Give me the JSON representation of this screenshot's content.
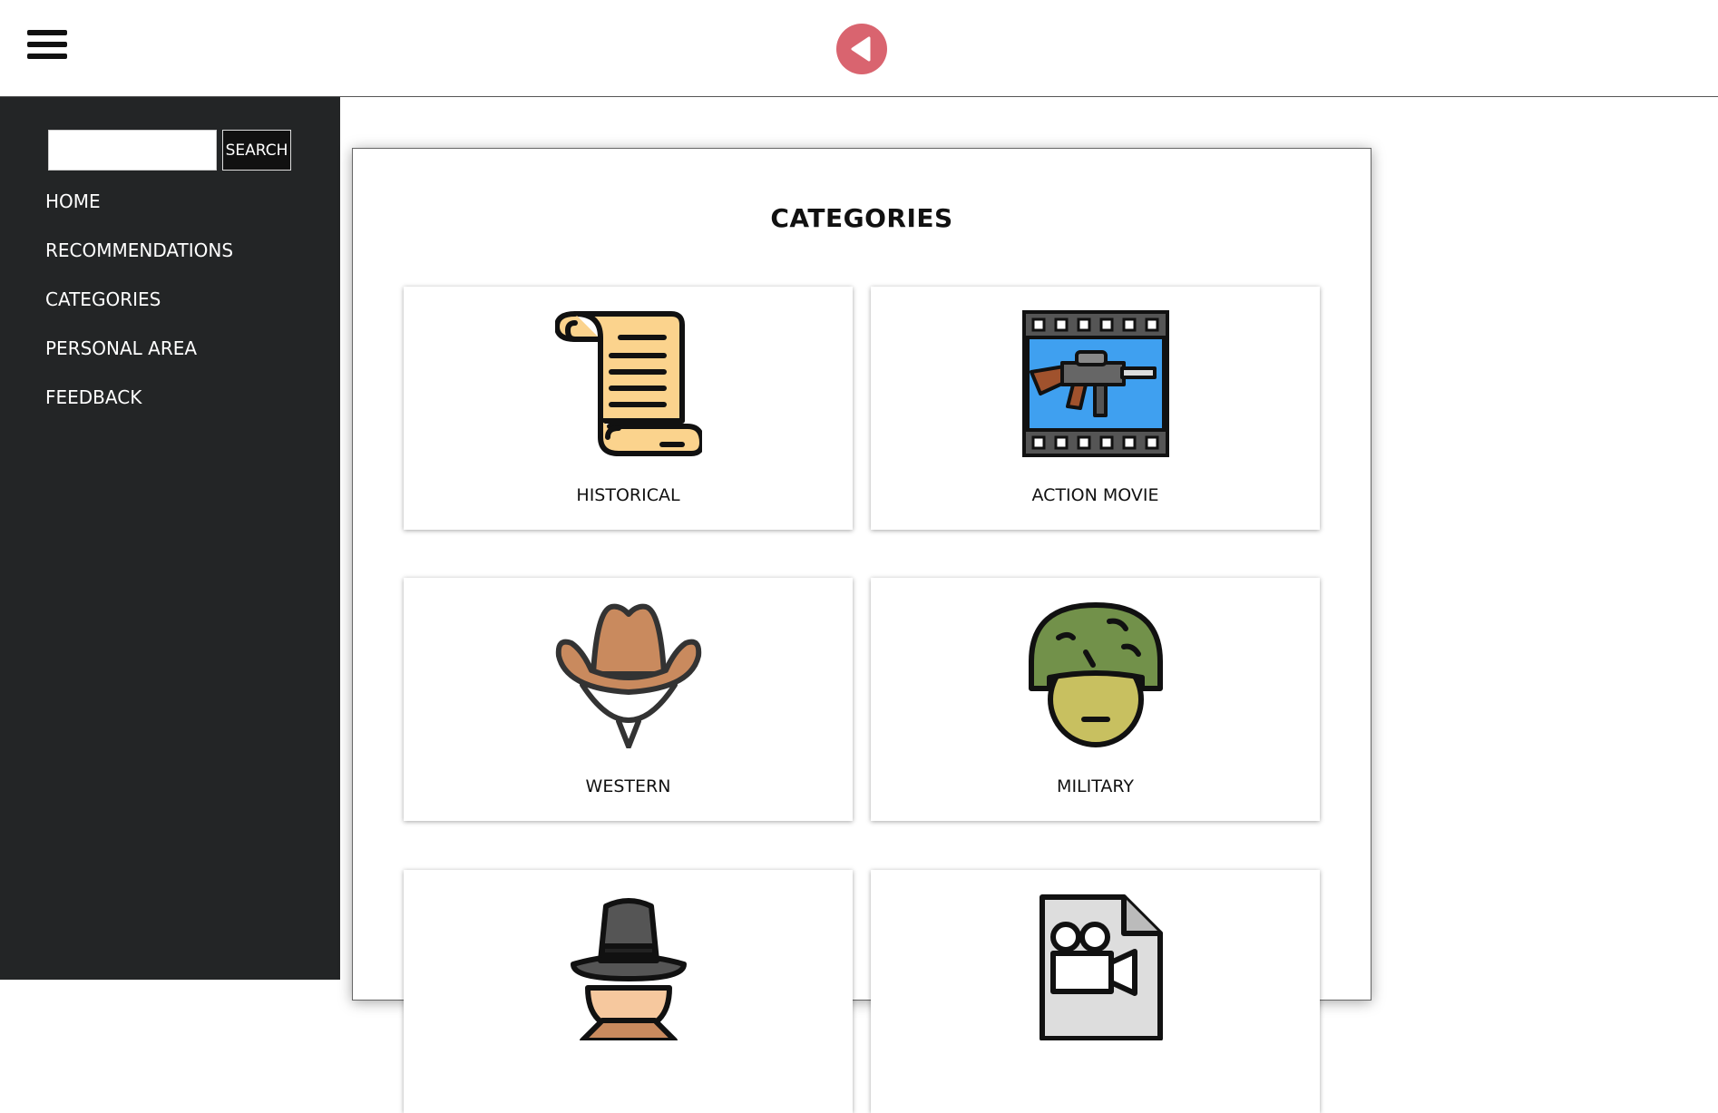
{
  "search": {
    "placeholder": "",
    "value": "",
    "button_label": "SEARCH"
  },
  "nav": {
    "items": [
      {
        "label": "HOME"
      },
      {
        "label": "RECOMMENDATIONS"
      },
      {
        "label": "CATEGORIES"
      },
      {
        "label": "PERSONAL AREA"
      },
      {
        "label": "FEEDBACK"
      }
    ]
  },
  "main": {
    "title": "CATEGORIES",
    "cards": [
      {
        "label": "HISTORICAL",
        "icon": "scroll-icon"
      },
      {
        "label": "ACTION MOVIE",
        "icon": "film-rifle-icon"
      },
      {
        "label": "WESTERN",
        "icon": "cowboy-hat-icon"
      },
      {
        "label": "MILITARY",
        "icon": "soldier-helmet-icon"
      },
      {
        "label": "",
        "icon": "detective-icon"
      },
      {
        "label": "",
        "icon": "film-file-icon"
      }
    ]
  },
  "colors": {
    "sidebar": "#232526",
    "back_button": "#d9646f",
    "accent_scroll": "#fbd38d",
    "film_screen": "#3fa0f0"
  }
}
